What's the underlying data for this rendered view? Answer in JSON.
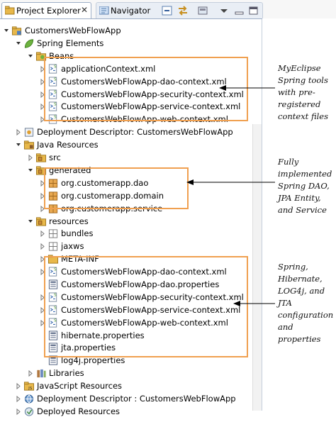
{
  "tabs": {
    "explorer": "Project Explorer",
    "explorer_close": "✕",
    "navigator": "Navigator"
  },
  "tree": [
    {
      "label": "CustomersWebFlowApp",
      "level": 0,
      "twisty": "open",
      "icon": "project"
    },
    {
      "label": "Spring Elements",
      "level": 1,
      "twisty": "open",
      "icon": "spring-leaf"
    },
    {
      "label": "Beans",
      "level": 2,
      "twisty": "open",
      "icon": "folder-beans"
    },
    {
      "label": "applicationContext.xml",
      "level": 3,
      "twisty": "closed",
      "icon": "spring-xml"
    },
    {
      "label": "CustomersWebFlowApp-dao-context.xml",
      "level": 3,
      "twisty": "closed",
      "icon": "spring-xml"
    },
    {
      "label": "CustomersWebFlowApp-security-context.xml",
      "level": 3,
      "twisty": "closed",
      "icon": "spring-xml"
    },
    {
      "label": "CustomersWebFlowApp-service-context.xml",
      "level": 3,
      "twisty": "closed",
      "icon": "spring-xml"
    },
    {
      "label": "CustomersWebFlowApp-web-context.xml",
      "level": 3,
      "twisty": "closed",
      "icon": "spring-xml"
    },
    {
      "label": "Deployment Descriptor: CustomersWebFlowApp",
      "level": 1,
      "twisty": "closed",
      "icon": "deployment"
    },
    {
      "label": "Java Resources",
      "level": 1,
      "twisty": "open",
      "icon": "java-resources"
    },
    {
      "label": "src",
      "level": 2,
      "twisty": "closed",
      "icon": "source-folder"
    },
    {
      "label": "generated",
      "level": 2,
      "twisty": "open",
      "icon": "source-folder"
    },
    {
      "label": "org.customerapp.dao",
      "level": 3,
      "twisty": "closed",
      "icon": "package"
    },
    {
      "label": "org.customerapp.domain",
      "level": 3,
      "twisty": "closed",
      "icon": "package"
    },
    {
      "label": "org.customerapp.service",
      "level": 3,
      "twisty": "closed",
      "icon": "package"
    },
    {
      "label": "resources",
      "level": 2,
      "twisty": "open",
      "icon": "source-folder"
    },
    {
      "label": "bundles",
      "level": 3,
      "twisty": "closed",
      "icon": "resource-package"
    },
    {
      "label": "jaxws",
      "level": 3,
      "twisty": "closed",
      "icon": "resource-package"
    },
    {
      "label": "META-INF",
      "level": 3,
      "twisty": "closed",
      "icon": "folder"
    },
    {
      "label": "CustomersWebFlowApp-dao-context.xml",
      "level": 3,
      "twisty": "closed",
      "icon": "spring-xml"
    },
    {
      "label": "CustomersWebFlowApp-dao.properties",
      "level": 3,
      "twisty": "none",
      "icon": "properties"
    },
    {
      "label": "CustomersWebFlowApp-security-context.xml",
      "level": 3,
      "twisty": "closed",
      "icon": "spring-xml"
    },
    {
      "label": "CustomersWebFlowApp-service-context.xml",
      "level": 3,
      "twisty": "closed",
      "icon": "spring-xml"
    },
    {
      "label": "CustomersWebFlowApp-web-context.xml",
      "level": 3,
      "twisty": "closed",
      "icon": "spring-xml"
    },
    {
      "label": "hibernate.properties",
      "level": 3,
      "twisty": "none",
      "icon": "properties"
    },
    {
      "label": "jta.properties",
      "level": 3,
      "twisty": "none",
      "icon": "properties"
    },
    {
      "label": "log4j.properties",
      "level": 3,
      "twisty": "none",
      "icon": "properties"
    },
    {
      "label": "Libraries",
      "level": 2,
      "twisty": "closed",
      "icon": "libraries"
    },
    {
      "label": "JavaScript Resources",
      "level": 1,
      "twisty": "closed",
      "icon": "js-resources"
    },
    {
      "label": "Deployment Descriptor : CustomersWebFlowApp",
      "level": 1,
      "twisty": "closed",
      "icon": "deployment-web"
    },
    {
      "label": "Deployed Resources",
      "level": 1,
      "twisty": "closed",
      "icon": "deployed"
    }
  ],
  "annotations": {
    "spring_tools": [
      "MyEclipse",
      "Spring tools",
      "with pre-",
      "registered",
      "context files"
    ],
    "generated": [
      "Fully",
      "implemented",
      "Spring DAO,",
      "JPA Entity,",
      "and Service"
    ],
    "config": [
      "Spring,",
      "Hibernate,",
      "LOG4j, and",
      "JTA",
      "configuration",
      "and",
      "properties"
    ]
  },
  "colors": {
    "highlight": "#f0a050",
    "tab_border": "#9fb0c8",
    "folder": "#e8b84a",
    "package": "#c88a3a"
  }
}
